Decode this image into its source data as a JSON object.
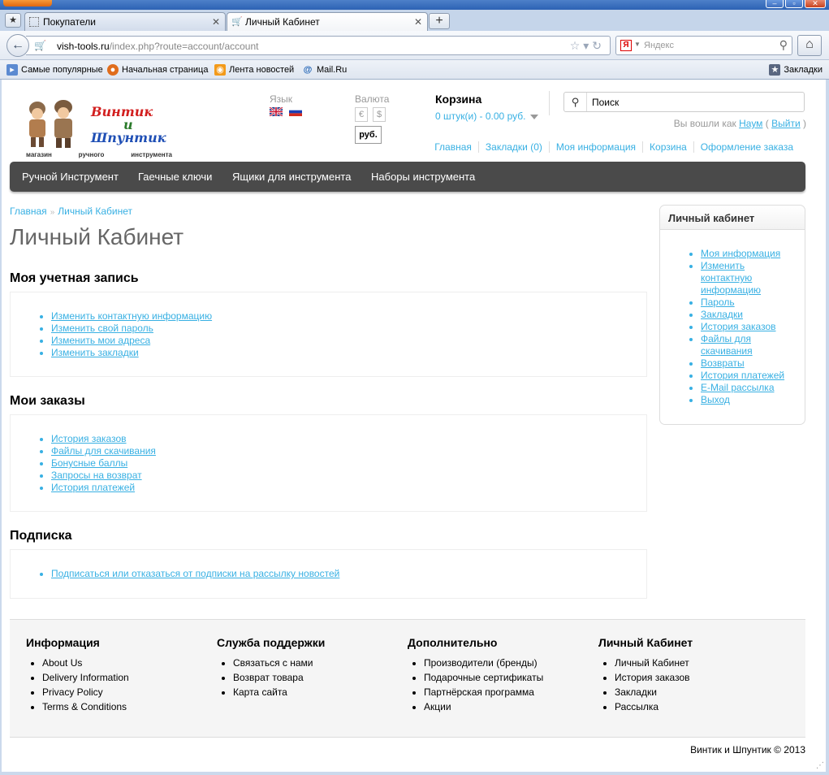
{
  "browser": {
    "tabs": [
      {
        "title": "Покупатели",
        "active": false
      },
      {
        "title": "Личный Кабинет",
        "active": true
      }
    ],
    "new_tab_label": "+",
    "url_domain": "vish-tools.ru",
    "url_path": "/index.php?route=account/account",
    "search_placeholder": "Яндекс",
    "bookmarks": [
      "Самые популярные",
      "Начальная страница",
      "Лента новостей",
      "Mail.Ru"
    ],
    "bookmarks_menu": "Закладки"
  },
  "header": {
    "logo_line1": "Винтик",
    "logo_line2": "и",
    "logo_line3": "Шпунтик",
    "logo_caption": [
      "магазин",
      "ручного",
      "инструмента"
    ],
    "language_label": "Язык",
    "currency_label": "Валюта",
    "currencies": [
      "€",
      "$",
      "руб."
    ],
    "cart_title": "Корзина",
    "cart_summary": "0 штук(и) - 0.00 руб.",
    "search_value": "Поиск",
    "welcome_prefix": "Вы вошли как",
    "welcome_user": "Наум",
    "welcome_paren_open": "(",
    "welcome_logout": "Выйти",
    "welcome_paren_close": ")",
    "top_links": [
      "Главная",
      "Закладки (0)",
      "Моя информация",
      "Корзина",
      "Оформление заказа"
    ]
  },
  "menu": [
    "Ручной Инструмент",
    "Гаечные ключи",
    "Ящики для инструмента",
    "Наборы инструмента"
  ],
  "breadcrumb": [
    "Главная",
    "Личный Кабинет"
  ],
  "breadcrumb_sep": "»",
  "page_title": "Личный Кабинет",
  "sections": [
    {
      "title": "Моя учетная запись",
      "links": [
        "Изменить контактную информацию",
        "Изменить свой пароль",
        "Изменить мои адреса",
        "Изменить закладки"
      ]
    },
    {
      "title": "Мои заказы",
      "links": [
        "История заказов",
        "Файлы для скачивания",
        "Бонусные баллы",
        "Запросы на возврат",
        "История платежей"
      ]
    },
    {
      "title": "Подписка",
      "links": [
        "Подписаться или отказаться от подписки на рассылку новостей"
      ]
    }
  ],
  "sidebar": {
    "title": "Личный кабинет",
    "links": [
      "Моя информация",
      "Изменить контактную информацию",
      "Пароль",
      "Закладки",
      "История заказов",
      "Файлы для скачивания",
      "Возвраты",
      "История платежей",
      "E-Mail рассылка",
      "Выход"
    ]
  },
  "footer": {
    "columns": [
      {
        "title": "Информация",
        "items": [
          "About Us",
          "Delivery Information",
          "Privacy Policy",
          "Terms & Conditions"
        ]
      },
      {
        "title": "Служба поддержки",
        "items": [
          "Связаться с нами",
          "Возврат товара",
          "Карта сайта"
        ]
      },
      {
        "title": "Дополнительно",
        "items": [
          "Производители (бренды)",
          "Подарочные сертификаты",
          "Партнёрская программа",
          "Акции"
        ]
      },
      {
        "title": "Личный Кабинет",
        "items": [
          "Личный Кабинет",
          "История заказов",
          "Закладки",
          "Рассылка"
        ]
      }
    ],
    "powered": "Винтик и Шпунтик © 2013"
  },
  "colors": {
    "link": "#38B0E3",
    "menu_bg": "#4a4a4a"
  }
}
